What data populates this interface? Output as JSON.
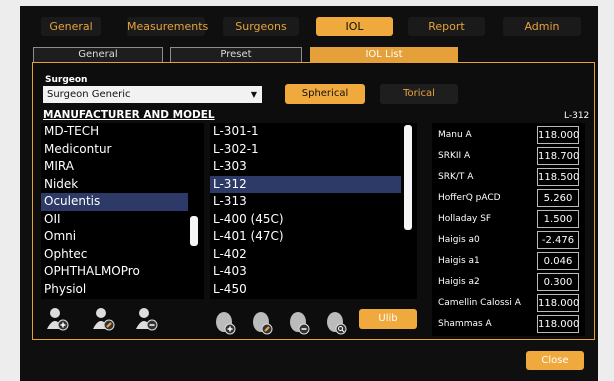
{
  "top_tabs": [
    {
      "label": "General",
      "active": false
    },
    {
      "label": "Measurements",
      "active": false
    },
    {
      "label": "Surgeons",
      "active": false
    },
    {
      "label": "IOL",
      "active": true
    },
    {
      "label": "Report",
      "active": false
    },
    {
      "label": "Admin",
      "active": false
    }
  ],
  "sub_tabs": [
    {
      "label": "General",
      "active": false
    },
    {
      "label": "Preset",
      "active": false
    },
    {
      "label": "IOL List",
      "active": true
    }
  ],
  "surgeon": {
    "label": "Surgeon",
    "value": "Surgeon Generic"
  },
  "lens_type": {
    "spherical": "Spherical",
    "torical": "Torical",
    "selected": "Spherical"
  },
  "manufacturers": {
    "header": "MANUFACTURER AND MODEL",
    "items": [
      "MD-TECH",
      "Medicontur",
      "MIRA",
      "Nidek",
      "Oculentis",
      "OII",
      "Omni",
      "Ophtec",
      "OPHTHALMOPro",
      "Physiol"
    ],
    "selected": "Oculentis"
  },
  "models": {
    "items": [
      "L-301-1",
      "L-302-1",
      "L-303",
      "L-312",
      "L-313",
      "L-400 (45C)",
      "L-401 (47C)",
      "L-402",
      "L-403",
      "L-450"
    ],
    "selected": "L-312"
  },
  "selected_model_label": "L-312",
  "parameters": [
    {
      "label": "Manu A",
      "value": "118.000"
    },
    {
      "label": "SRKII A",
      "value": "118.700"
    },
    {
      "label": "SRK/T A",
      "value": "118.500"
    },
    {
      "label": "HofferQ pACD",
      "value": "5.260"
    },
    {
      "label": "Holladay SF",
      "value": "1.500"
    },
    {
      "label": "Haigis a0",
      "value": "-2.476"
    },
    {
      "label": "Haigis a1",
      "value": "0.046"
    },
    {
      "label": "Haigis a2",
      "value": "0.300"
    },
    {
      "label": "Camellin Calossi A",
      "value": "118.000"
    },
    {
      "label": "Shammas A",
      "value": "118.000"
    }
  ],
  "ulib_label": "Ulib",
  "close_label": "Close",
  "manufacturer_icons": [
    "add-manufacturer-icon",
    "edit-manufacturer-icon",
    "delete-manufacturer-icon"
  ],
  "model_icons": [
    "add-lens-icon",
    "edit-lens-icon",
    "delete-lens-icon",
    "search-lens-icon"
  ],
  "colors": {
    "accent": "#f0a93c",
    "selection": "#2d3a68"
  }
}
